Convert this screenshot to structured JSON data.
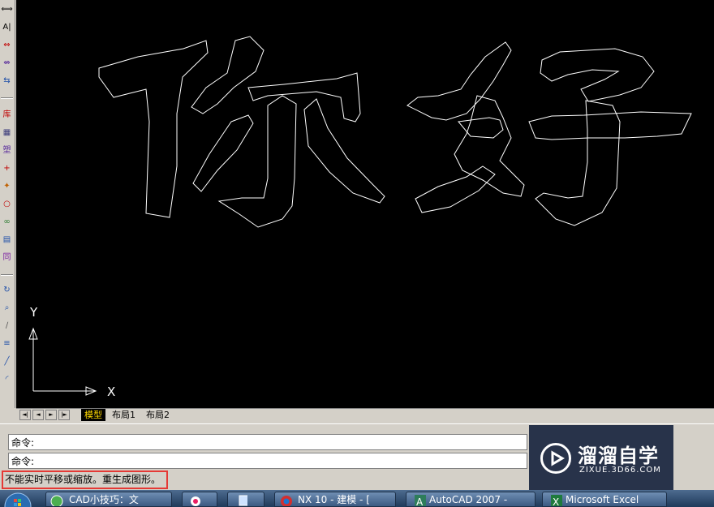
{
  "toolbar": {
    "items": [
      {
        "name": "linear-dimension-icon",
        "glyph": "⟺",
        "color": "#000000"
      },
      {
        "name": "text-style-icon",
        "glyph": "A|",
        "color": "#000000"
      },
      {
        "name": "aligned-dimension-icon",
        "glyph": "⇔",
        "color": "#c00000"
      },
      {
        "name": "dimension-edit-icon",
        "glyph": "⇎",
        "color": "#5a2d9c"
      },
      {
        "name": "dimension-update-icon",
        "glyph": "⇆",
        "color": "#1f4fa8"
      },
      {
        "name": "library-icon",
        "glyph": "库",
        "color": "#c00000"
      },
      {
        "name": "table-grid-icon",
        "glyph": "▦",
        "color": "#3a3a7a"
      },
      {
        "name": "block-icon",
        "glyph": "塑",
        "color": "#5a2d9c"
      },
      {
        "name": "cross-icon",
        "glyph": "+",
        "color": "#c00000"
      },
      {
        "name": "rotate-block-icon",
        "glyph": "✦",
        "color": "#c06000"
      },
      {
        "name": "circle-icon",
        "glyph": "○",
        "color": "#c00000"
      },
      {
        "name": "link-icon",
        "glyph": "∞",
        "color": "#2e7d32"
      },
      {
        "name": "calculator-icon",
        "glyph": "▤",
        "color": "#1f4fa8"
      },
      {
        "name": "same-icon",
        "glyph": "同",
        "color": "#7b1fa2"
      },
      {
        "name": "refresh-icon",
        "glyph": "↻",
        "color": "#1f4fa8"
      },
      {
        "name": "zoom-icon",
        "glyph": "⌕",
        "color": "#1f4fa8"
      },
      {
        "name": "measure-icon",
        "glyph": "∕",
        "color": "#555555"
      },
      {
        "name": "layer-icon",
        "glyph": "≡",
        "color": "#1f4fa8"
      },
      {
        "name": "line-icon",
        "glyph": "╱",
        "color": "#1f4fa8"
      },
      {
        "name": "arc-icon",
        "glyph": "◜",
        "color": "#1f4fa8"
      }
    ]
  },
  "canvas": {
    "background": "#000000",
    "stroke_color": "#ffffff",
    "drawing_text": "你好",
    "ucs": {
      "y_label": "Y",
      "x_label": "X"
    }
  },
  "layout_tabs": {
    "nav": [
      "◄|",
      "◄",
      "►",
      "|►"
    ],
    "tabs": [
      {
        "label": "模型",
        "active": true
      },
      {
        "label": "布局1",
        "active": false
      },
      {
        "label": "布局2",
        "active": false
      }
    ]
  },
  "command_window": {
    "lines": [
      "命令:",
      "命令:"
    ]
  },
  "status": {
    "message": "不能实时平移或缩放。重生成图形。",
    "highlight_color": "#e53935"
  },
  "watermark": {
    "title": "溜溜自学",
    "url": "ZIXUE.3D66.COM"
  },
  "taskbar": {
    "tasks": [
      {
        "label": "CAD小技巧：文",
        "icon": "green-refresh-icon"
      },
      {
        "label": "",
        "icon": "color-wheel-icon"
      },
      {
        "label": "",
        "icon": "window-icon"
      },
      {
        "label": "NX 10 - 建模 - [",
        "icon": "nx-logo-icon"
      },
      {
        "label": "AutoCAD 2007 -",
        "icon": "autocad-icon"
      },
      {
        "label": "Microsoft Excel",
        "icon": "excel-icon"
      }
    ]
  }
}
